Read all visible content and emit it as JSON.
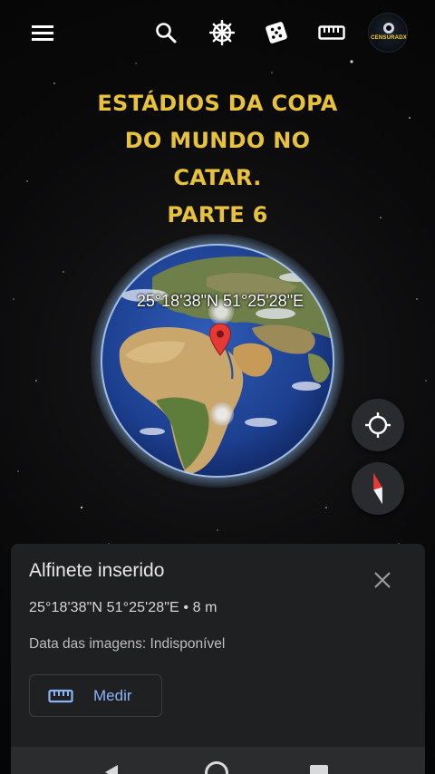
{
  "toolbar": {
    "icons": [
      "menu-icon",
      "search-icon",
      "voyager-wheel-icon",
      "dice-icon",
      "ruler-icon"
    ],
    "avatar_brand": "CENSURADX"
  },
  "overlay": {
    "title_lines": [
      "ESTÁDIOS DA COPA",
      "DO MUNDO NO",
      "CATAR.",
      "PARTE 6"
    ]
  },
  "globe": {
    "coord_label": "25°18'38\"N 51°25'28\"E"
  },
  "controls": {
    "icons": [
      "my-location-icon",
      "compass-icon"
    ]
  },
  "sheet": {
    "title": "Alfinete inserido",
    "coords": "25°18'38\"N 51°25'28\"E • 8 m",
    "imagery_date": "Data das imagens: Indisponível",
    "measure_label": "Medir"
  },
  "colors": {
    "title_gold": "#e8c23a",
    "link_blue": "#8ab4f8",
    "sheet_bg": "#1f2022",
    "pin_red": "#e53935"
  }
}
